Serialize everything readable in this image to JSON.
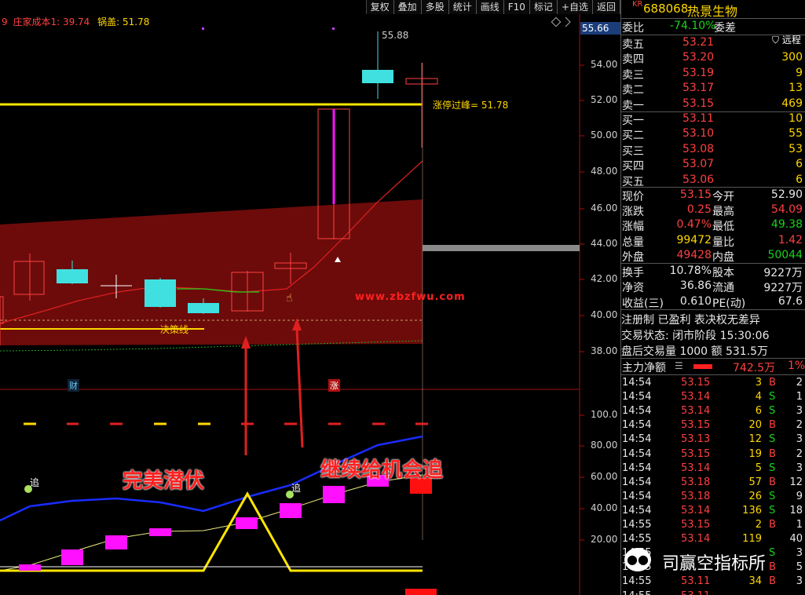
{
  "toolbar": {
    "buttons": [
      "复权",
      "叠加",
      "多股",
      "统计",
      "画线",
      "F10",
      "标记",
      "+自选",
      "返回"
    ]
  },
  "legend": {
    "prefix": "9",
    "cost_label": "庄家成本1: 39.74",
    "pot_label": "锅盖: 51.78"
  },
  "price_axis": {
    "current_badge": "55.66",
    "ticks": [
      "54.00",
      "52.00",
      "50.00",
      "48.00",
      "46.00",
      "44.00",
      "42.00",
      "40.00",
      "38.00"
    ]
  },
  "indicator_axis": {
    "ticks": [
      "100.0",
      "80.00",
      "60.00",
      "40.00",
      "20.00"
    ]
  },
  "annotations": {
    "high_price": "55.88",
    "limit_line": "涨停过峰= 51.78",
    "decision_line": "决策线",
    "watermark": "www.zbzfwu.com",
    "badge_cai": "财",
    "badge_zhang": "涨",
    "zhui_1": "追",
    "zhui_2": "追",
    "caption_1": "完美潜伏",
    "caption_2": "继续给机会追",
    "wechat_brand": "司赢空指标所"
  },
  "stock": {
    "prefix": "KR",
    "code": "688068",
    "name": "热景生物",
    "ratio_label": "委比",
    "ratio_value": "-74.10%",
    "diff_label": "委差",
    "remote_label": "远程"
  },
  "sell_levels": [
    {
      "label": "卖五",
      "price": "53.21",
      "vol": ""
    },
    {
      "label": "卖四",
      "price": "53.20",
      "vol": "300"
    },
    {
      "label": "卖三",
      "price": "53.19",
      "vol": "9"
    },
    {
      "label": "卖二",
      "price": "53.17",
      "vol": "13"
    },
    {
      "label": "卖一",
      "price": "53.15",
      "vol": "469"
    }
  ],
  "buy_levels": [
    {
      "label": "买一",
      "price": "53.11",
      "vol": "10"
    },
    {
      "label": "买二",
      "price": "53.10",
      "vol": "55"
    },
    {
      "label": "买三",
      "price": "53.08",
      "vol": "53"
    },
    {
      "label": "买四",
      "price": "53.07",
      "vol": "6"
    },
    {
      "label": "买五",
      "price": "53.06",
      "vol": "6"
    }
  ],
  "quote_stats": [
    {
      "l1": "现价",
      "v1": "53.15",
      "c1": "red",
      "l2": "今开",
      "v2": "52.90",
      "c2": "wht"
    },
    {
      "l1": "涨跌",
      "v1": "0.25",
      "c1": "red",
      "l2": "最高",
      "v2": "54.09",
      "c2": "red"
    },
    {
      "l1": "涨幅",
      "v1": "0.47%",
      "c1": "red",
      "l2": "最低",
      "v2": "49.38",
      "c2": "grn"
    },
    {
      "l1": "总量",
      "v1": "99472",
      "c1": "ylw",
      "l2": "量比",
      "v2": "1.42",
      "c2": "red"
    },
    {
      "l1": "外盘",
      "v1": "49428",
      "c1": "red",
      "l2": "内盘",
      "v2": "50044",
      "c2": "grn"
    }
  ],
  "fundamentals": [
    {
      "l1": "换手",
      "v1": "10.78%",
      "l2": "股本",
      "v2": "9227万"
    },
    {
      "l1": "净资",
      "v1": "36.86",
      "l2": "流通",
      "v2": "9227万"
    },
    {
      "l1": "收益(三)",
      "v1": "0.610",
      "l2": "PE(动)",
      "v2": "67.6"
    }
  ],
  "status": {
    "registration": "注册制 已盈利 表决权无差异",
    "trade_state": "交易状态: 闭市阶段 15:30:06",
    "after_hours": "盘后交易量 1000 额 531.5万",
    "main_net_label": "主力净额",
    "main_net_value": "742.5万",
    "main_net_pct": "1%"
  },
  "ticks": [
    {
      "t": "14:54",
      "p": "53.15",
      "c": "red",
      "v": "3",
      "s": "B",
      "n": "2"
    },
    {
      "t": "14:54",
      "p": "53.14",
      "c": "red",
      "v": "4",
      "s": "S",
      "n": "1"
    },
    {
      "t": "14:54",
      "p": "53.14",
      "c": "red",
      "v": "6",
      "s": "S",
      "n": "3"
    },
    {
      "t": "14:54",
      "p": "53.15",
      "c": "red",
      "v": "20",
      "s": "B",
      "n": "2"
    },
    {
      "t": "14:54",
      "p": "53.13",
      "c": "red",
      "v": "12",
      "s": "S",
      "n": "3"
    },
    {
      "t": "14:54",
      "p": "53.15",
      "c": "red",
      "v": "19",
      "s": "B",
      "n": "2"
    },
    {
      "t": "14:54",
      "p": "53.14",
      "c": "red",
      "v": "5",
      "s": "S",
      "n": "3"
    },
    {
      "t": "14:54",
      "p": "53.18",
      "c": "red",
      "v": "57",
      "s": "B",
      "n": "12"
    },
    {
      "t": "14:54",
      "p": "53.18",
      "c": "red",
      "v": "26",
      "s": "S",
      "n": "9"
    },
    {
      "t": "14:54",
      "p": "53.14",
      "c": "red",
      "v": "136",
      "s": "S",
      "n": "18"
    },
    {
      "t": "14:55",
      "p": "53.15",
      "c": "red",
      "v": "2",
      "s": "B",
      "n": "1"
    },
    {
      "t": "14:55",
      "p": "53.14",
      "c": "red",
      "v": "119",
      "s": "",
      "n": "40"
    },
    {
      "t": "14:55",
      "p": "",
      "c": "red",
      "v": "",
      "s": "S",
      "n": "3"
    },
    {
      "t": "14:55",
      "p": "",
      "c": "red",
      "v": "",
      "s": "B",
      "n": "5"
    },
    {
      "t": "14:55",
      "p": "53.11",
      "c": "red",
      "v": "34",
      "s": "B",
      "n": "3"
    },
    {
      "t": "14:55",
      "p": "53.11",
      "c": "red",
      "v": "",
      "s": "",
      "n": ""
    }
  ],
  "colors": {
    "up": "#ff4040",
    "down": "#40e0e0",
    "yellow": "#ffd700",
    "blue_line": "#1a2cff",
    "magenta": "#ff10ff"
  }
}
